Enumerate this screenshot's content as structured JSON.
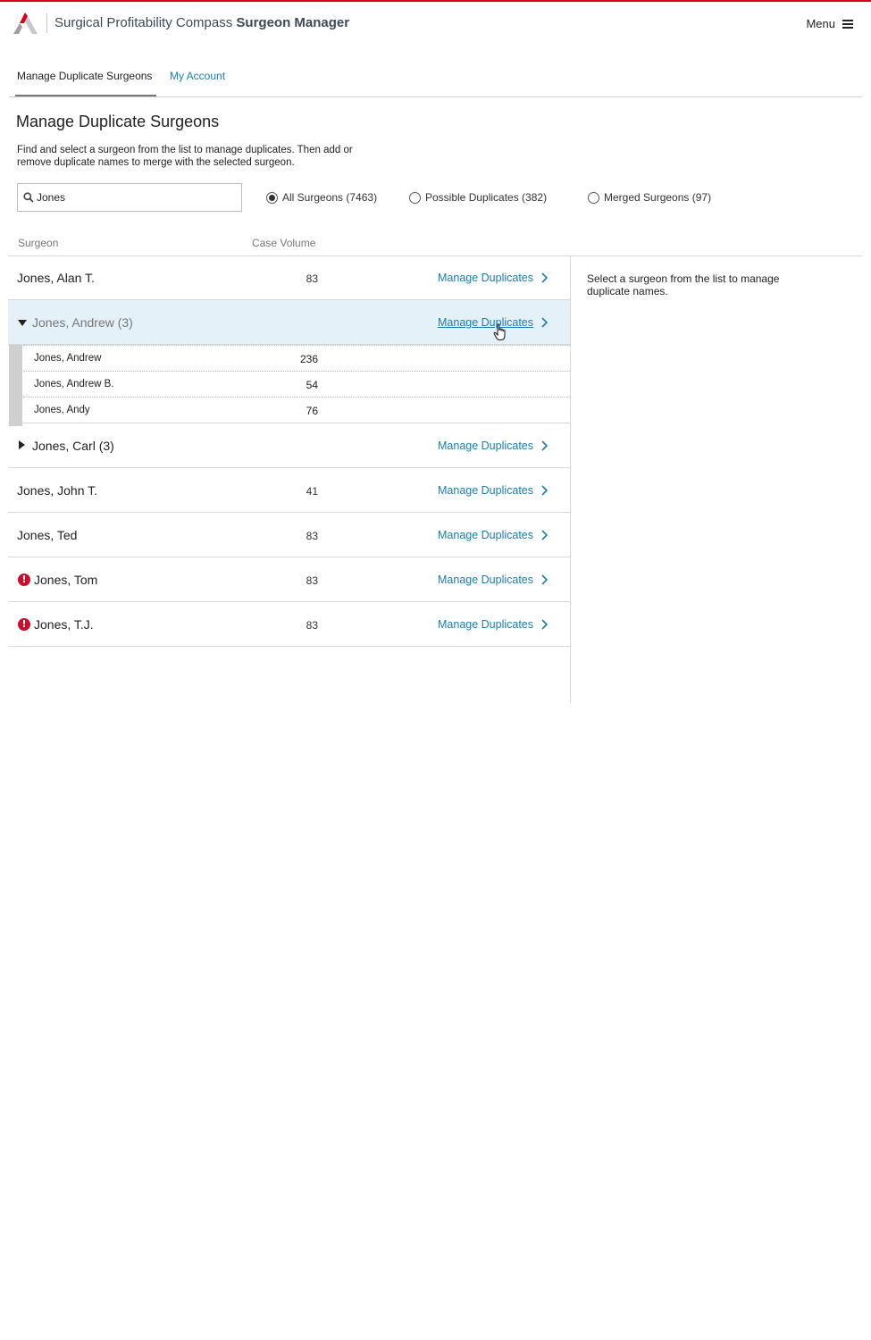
{
  "colors": {
    "brand_red": "#d6001c",
    "link": "#1a7db5",
    "selected_row": "#e4f1f8",
    "alert": "#c8102e"
  },
  "header": {
    "product_name": "Surgical Profitability Compass",
    "module_name": "Surgeon Manager",
    "menu_label": "Menu",
    "logo_icon": "compass-logo-icon",
    "menu_icon": "hamburger-icon"
  },
  "tabs": [
    {
      "label": "Manage Duplicate Surgeons",
      "active": true
    },
    {
      "label": "My Account",
      "active": false
    }
  ],
  "page": {
    "title": "Manage Duplicate Surgeons",
    "intro": "Find and select a surgeon from the list to manage duplicates. Then add or remove duplicate names to merge with the selected surgeon."
  },
  "search": {
    "value": "Jones",
    "placeholder": ""
  },
  "filters": [
    {
      "label": "All Surgeons (7463)",
      "selected": true
    },
    {
      "label": "Possible Duplicates (382)",
      "selected": false
    },
    {
      "label": "Merged Surgeons (97)",
      "selected": false
    }
  ],
  "columns": {
    "surgeon": "Surgeon",
    "case_volume": "Case Volume"
  },
  "manage_label": "Manage Duplicates",
  "rows": [
    {
      "name": "Jones, Alan T.",
      "volume": "83"
    },
    {
      "name": "Jones, Andrew (3)",
      "volume": "",
      "expanded": true,
      "selected": true,
      "children": [
        {
          "name": "Jones, Andrew",
          "volume": "236"
        },
        {
          "name": "Jones, Andrew B.",
          "volume": "54"
        },
        {
          "name": "Jones, Andy",
          "volume": "76"
        }
      ]
    },
    {
      "name": "Jones, Carl (3)",
      "volume": "",
      "expanded": false
    },
    {
      "name": "Jones, John T.",
      "volume": "41"
    },
    {
      "name": "Jones, Ted",
      "volume": "83"
    },
    {
      "name": "Jones, Tom",
      "volume": "83",
      "alert": true
    },
    {
      "name": "Jones, T.J.",
      "volume": "83",
      "alert": true
    }
  ],
  "alert_glyph": "!",
  "detail_hint": "Select a surgeon from the list to manage duplicate names."
}
